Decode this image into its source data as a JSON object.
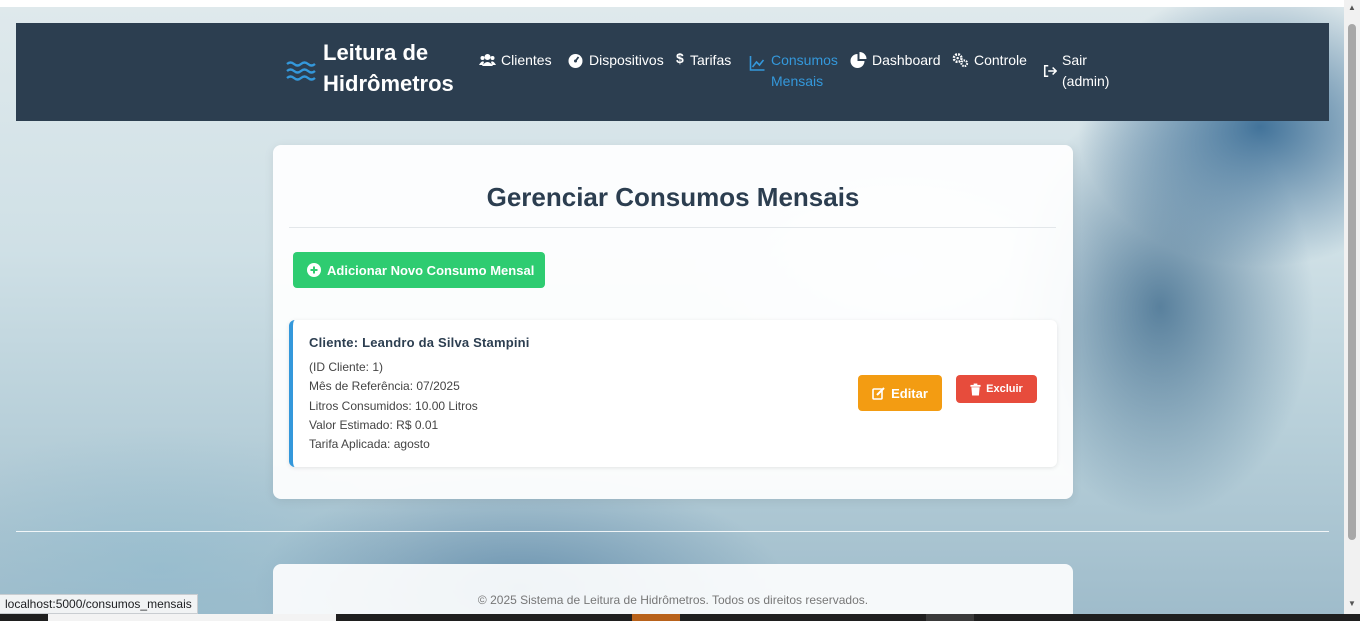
{
  "app": {
    "brand": "Leitura de Hidrômetros"
  },
  "nav": {
    "items": [
      {
        "label": "Clientes",
        "icon": "users-icon"
      },
      {
        "label": "Dispositivos",
        "icon": "gauge-icon"
      },
      {
        "label": "Tarifas",
        "icon": "dollar-icon"
      },
      {
        "label": "Consumos Mensais",
        "icon": "chart-line-icon",
        "active": true
      },
      {
        "label": "Dashboard",
        "icon": "pie-chart-icon"
      },
      {
        "label": "Controle",
        "icon": "cogs-icon"
      },
      {
        "label": "Sair (admin)",
        "icon": "sign-out-icon"
      }
    ]
  },
  "page": {
    "title": "Gerenciar Consumos Mensais",
    "add_button": "Adicionar Novo Consumo Mensal"
  },
  "records": [
    {
      "client": "Cliente: Leandro da Silva Stampini",
      "client_id": "(ID Cliente: 1)",
      "reference_month": "Mês de Referência: 07/2025",
      "liters": "Litros Consumidos: 10.00 Litros",
      "estimated_value": "Valor Estimado: R$ 0.01",
      "tariff": "Tarifa Aplicada: agosto",
      "edit_label": "Editar",
      "delete_label": "Excluir"
    }
  ],
  "footer": {
    "text": "© 2025 Sistema de Leitura de Hidrômetros. Todos os direitos reservados."
  },
  "status_bar": {
    "url": "localhost:5000/consumos_mensais"
  },
  "colors": {
    "navbar": "#2c3e50",
    "accent": "#3498db",
    "success": "#2ecc71",
    "warning": "#f39c12",
    "danger": "#e74c3c"
  }
}
